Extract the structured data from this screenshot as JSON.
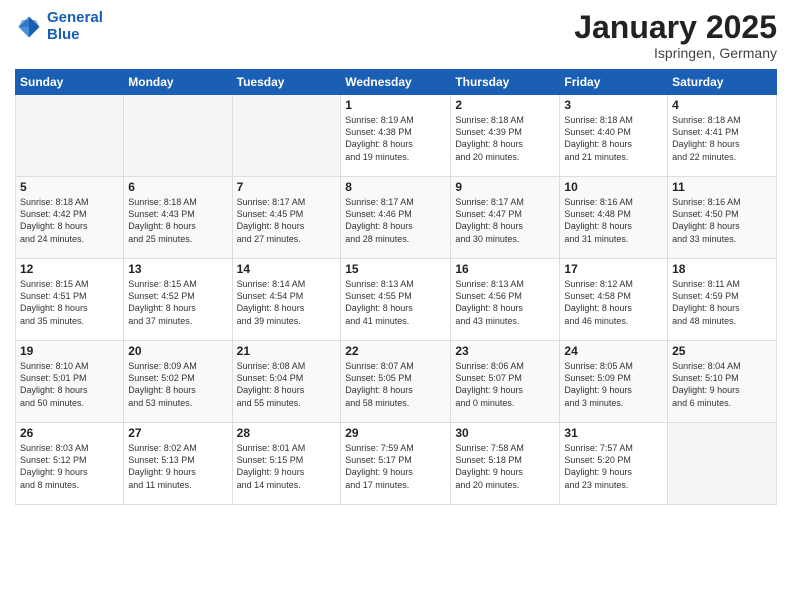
{
  "header": {
    "logo_line1": "General",
    "logo_line2": "Blue",
    "month_title": "January 2025",
    "location": "Ispringen, Germany"
  },
  "weekdays": [
    "Sunday",
    "Monday",
    "Tuesday",
    "Wednesday",
    "Thursday",
    "Friday",
    "Saturday"
  ],
  "weeks": [
    [
      {
        "num": "",
        "info": ""
      },
      {
        "num": "",
        "info": ""
      },
      {
        "num": "",
        "info": ""
      },
      {
        "num": "1",
        "info": "Sunrise: 8:19 AM\nSunset: 4:38 PM\nDaylight: 8 hours\nand 19 minutes."
      },
      {
        "num": "2",
        "info": "Sunrise: 8:18 AM\nSunset: 4:39 PM\nDaylight: 8 hours\nand 20 minutes."
      },
      {
        "num": "3",
        "info": "Sunrise: 8:18 AM\nSunset: 4:40 PM\nDaylight: 8 hours\nand 21 minutes."
      },
      {
        "num": "4",
        "info": "Sunrise: 8:18 AM\nSunset: 4:41 PM\nDaylight: 8 hours\nand 22 minutes."
      }
    ],
    [
      {
        "num": "5",
        "info": "Sunrise: 8:18 AM\nSunset: 4:42 PM\nDaylight: 8 hours\nand 24 minutes."
      },
      {
        "num": "6",
        "info": "Sunrise: 8:18 AM\nSunset: 4:43 PM\nDaylight: 8 hours\nand 25 minutes."
      },
      {
        "num": "7",
        "info": "Sunrise: 8:17 AM\nSunset: 4:45 PM\nDaylight: 8 hours\nand 27 minutes."
      },
      {
        "num": "8",
        "info": "Sunrise: 8:17 AM\nSunset: 4:46 PM\nDaylight: 8 hours\nand 28 minutes."
      },
      {
        "num": "9",
        "info": "Sunrise: 8:17 AM\nSunset: 4:47 PM\nDaylight: 8 hours\nand 30 minutes."
      },
      {
        "num": "10",
        "info": "Sunrise: 8:16 AM\nSunset: 4:48 PM\nDaylight: 8 hours\nand 31 minutes."
      },
      {
        "num": "11",
        "info": "Sunrise: 8:16 AM\nSunset: 4:50 PM\nDaylight: 8 hours\nand 33 minutes."
      }
    ],
    [
      {
        "num": "12",
        "info": "Sunrise: 8:15 AM\nSunset: 4:51 PM\nDaylight: 8 hours\nand 35 minutes."
      },
      {
        "num": "13",
        "info": "Sunrise: 8:15 AM\nSunset: 4:52 PM\nDaylight: 8 hours\nand 37 minutes."
      },
      {
        "num": "14",
        "info": "Sunrise: 8:14 AM\nSunset: 4:54 PM\nDaylight: 8 hours\nand 39 minutes."
      },
      {
        "num": "15",
        "info": "Sunrise: 8:13 AM\nSunset: 4:55 PM\nDaylight: 8 hours\nand 41 minutes."
      },
      {
        "num": "16",
        "info": "Sunrise: 8:13 AM\nSunset: 4:56 PM\nDaylight: 8 hours\nand 43 minutes."
      },
      {
        "num": "17",
        "info": "Sunrise: 8:12 AM\nSunset: 4:58 PM\nDaylight: 8 hours\nand 46 minutes."
      },
      {
        "num": "18",
        "info": "Sunrise: 8:11 AM\nSunset: 4:59 PM\nDaylight: 8 hours\nand 48 minutes."
      }
    ],
    [
      {
        "num": "19",
        "info": "Sunrise: 8:10 AM\nSunset: 5:01 PM\nDaylight: 8 hours\nand 50 minutes."
      },
      {
        "num": "20",
        "info": "Sunrise: 8:09 AM\nSunset: 5:02 PM\nDaylight: 8 hours\nand 53 minutes."
      },
      {
        "num": "21",
        "info": "Sunrise: 8:08 AM\nSunset: 5:04 PM\nDaylight: 8 hours\nand 55 minutes."
      },
      {
        "num": "22",
        "info": "Sunrise: 8:07 AM\nSunset: 5:05 PM\nDaylight: 8 hours\nand 58 minutes."
      },
      {
        "num": "23",
        "info": "Sunrise: 8:06 AM\nSunset: 5:07 PM\nDaylight: 9 hours\nand 0 minutes."
      },
      {
        "num": "24",
        "info": "Sunrise: 8:05 AM\nSunset: 5:09 PM\nDaylight: 9 hours\nand 3 minutes."
      },
      {
        "num": "25",
        "info": "Sunrise: 8:04 AM\nSunset: 5:10 PM\nDaylight: 9 hours\nand 6 minutes."
      }
    ],
    [
      {
        "num": "26",
        "info": "Sunrise: 8:03 AM\nSunset: 5:12 PM\nDaylight: 9 hours\nand 8 minutes."
      },
      {
        "num": "27",
        "info": "Sunrise: 8:02 AM\nSunset: 5:13 PM\nDaylight: 9 hours\nand 11 minutes."
      },
      {
        "num": "28",
        "info": "Sunrise: 8:01 AM\nSunset: 5:15 PM\nDaylight: 9 hours\nand 14 minutes."
      },
      {
        "num": "29",
        "info": "Sunrise: 7:59 AM\nSunset: 5:17 PM\nDaylight: 9 hours\nand 17 minutes."
      },
      {
        "num": "30",
        "info": "Sunrise: 7:58 AM\nSunset: 5:18 PM\nDaylight: 9 hours\nand 20 minutes."
      },
      {
        "num": "31",
        "info": "Sunrise: 7:57 AM\nSunset: 5:20 PM\nDaylight: 9 hours\nand 23 minutes."
      },
      {
        "num": "",
        "info": ""
      }
    ]
  ]
}
